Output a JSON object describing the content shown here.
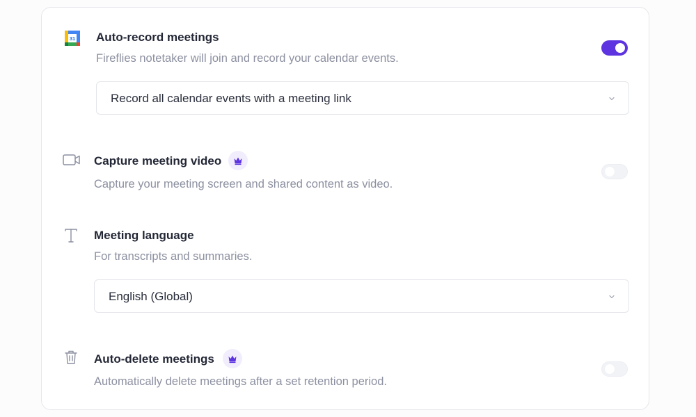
{
  "settings": {
    "auto_record": {
      "title": "Auto-record meetings",
      "description": "Fireflies notetaker will join and record your calendar events.",
      "toggle_on": true,
      "select_value": "Record all calendar events with a meeting link",
      "icon": "google-calendar-icon",
      "calendar_day": "31"
    },
    "capture_video": {
      "title": "Capture meeting video",
      "description": "Capture your meeting screen and shared content as video.",
      "toggle_on": false,
      "premium": true,
      "icon": "video-camera-icon"
    },
    "meeting_language": {
      "title": "Meeting language",
      "description": "For transcripts and summaries.",
      "select_value": "English (Global)",
      "icon": "text-icon"
    },
    "auto_delete": {
      "title": "Auto-delete meetings",
      "description": "Automatically delete meetings after a set retention period.",
      "toggle_on": false,
      "premium": true,
      "icon": "trash-icon"
    }
  },
  "colors": {
    "accent": "#5d34e0",
    "premium_badge_bg": "#f1edfd",
    "text_primary": "#242836",
    "text_secondary": "#8c90a0"
  }
}
